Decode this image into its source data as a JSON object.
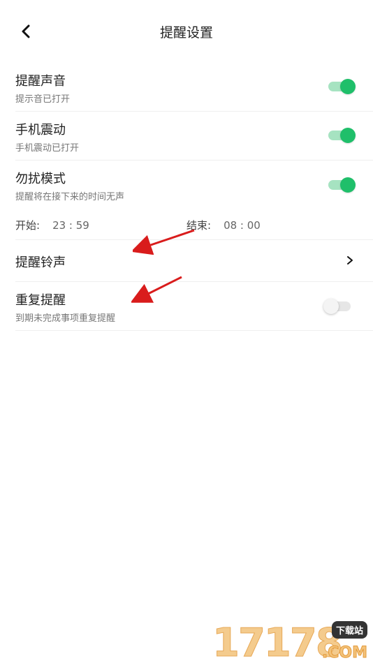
{
  "header": {
    "title": "提醒设置"
  },
  "settings": [
    {
      "title": "提醒声音",
      "subtitle": "提示音已打开",
      "enabled": true
    },
    {
      "title": "手机震动",
      "subtitle": "手机震动已打开",
      "enabled": true
    },
    {
      "title": "勿扰模式",
      "subtitle": "提醒将在接下来的时间无声",
      "enabled": true
    }
  ],
  "dnd_time": {
    "start_label": "开始:",
    "start_value": "23 : 59",
    "end_label": "结束:",
    "end_value": "08 : 00"
  },
  "ringtone": {
    "title": "提醒铃声"
  },
  "repeat": {
    "title": "重复提醒",
    "subtitle": "到期未完成事项重复提醒",
    "enabled": false
  },
  "watermark": {
    "number": "17178",
    "badge": "下载站",
    "suffix": ".COM"
  },
  "colors": {
    "toggle_on": "#1fbf6a",
    "annotation_arrow": "#d91c1c"
  }
}
